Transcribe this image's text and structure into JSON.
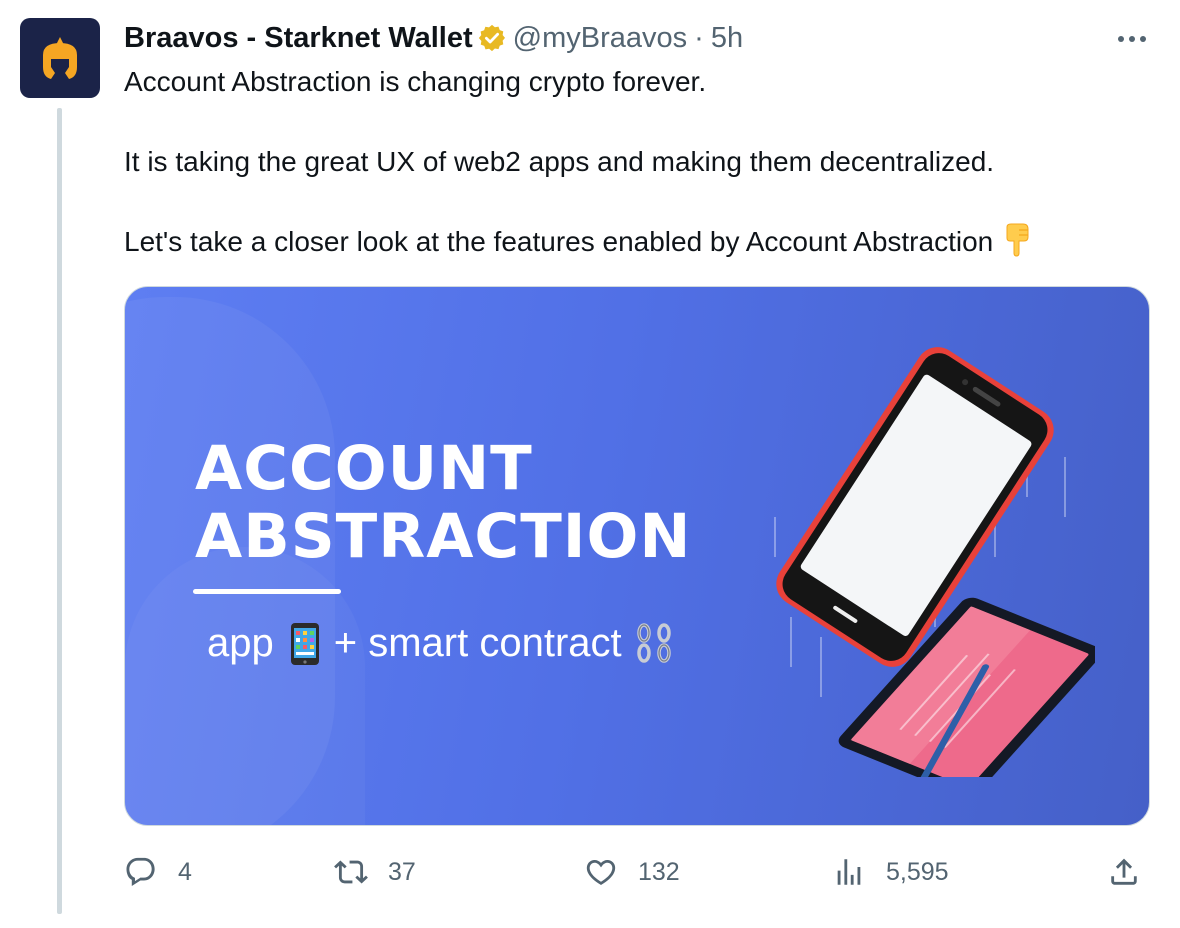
{
  "author": {
    "display_name": "Braavos - Starknet Wallet",
    "handle": "@myBraavos",
    "separator": "·",
    "time": "5h",
    "verified": true,
    "verified_color": "#e8b923"
  },
  "menu": {
    "icon": "more-horizontal-icon"
  },
  "tweet": {
    "paragraphs": [
      "Account Abstraction is changing crypto forever.",
      "It is taking the great UX of web2 apps and making them decentralized.",
      "Let's take a closer look at the features enabled by Account Abstraction"
    ],
    "trailing_emoji": "backhand-index-pointing-down"
  },
  "media": {
    "title_line1": "ACCOUNT",
    "title_line2": "ABSTRACTION",
    "subtitle_part1": "app",
    "subtitle_part2": "+ smart contract",
    "background_color": "#5672e8",
    "subtitle_icons": [
      "mobile-phone-icon",
      "chain-icon"
    ]
  },
  "actions": {
    "replies": "4",
    "retweets": "37",
    "likes": "132",
    "views": "5,595",
    "icons": [
      "reply-icon",
      "retweet-icon",
      "like-icon",
      "views-icon",
      "share-icon"
    ]
  },
  "colors": {
    "text": "#0f1419",
    "secondary": "#536471",
    "thread_line": "#cfd9de",
    "avatar_bg": "#1b2348",
    "logo": "#f5a623"
  }
}
